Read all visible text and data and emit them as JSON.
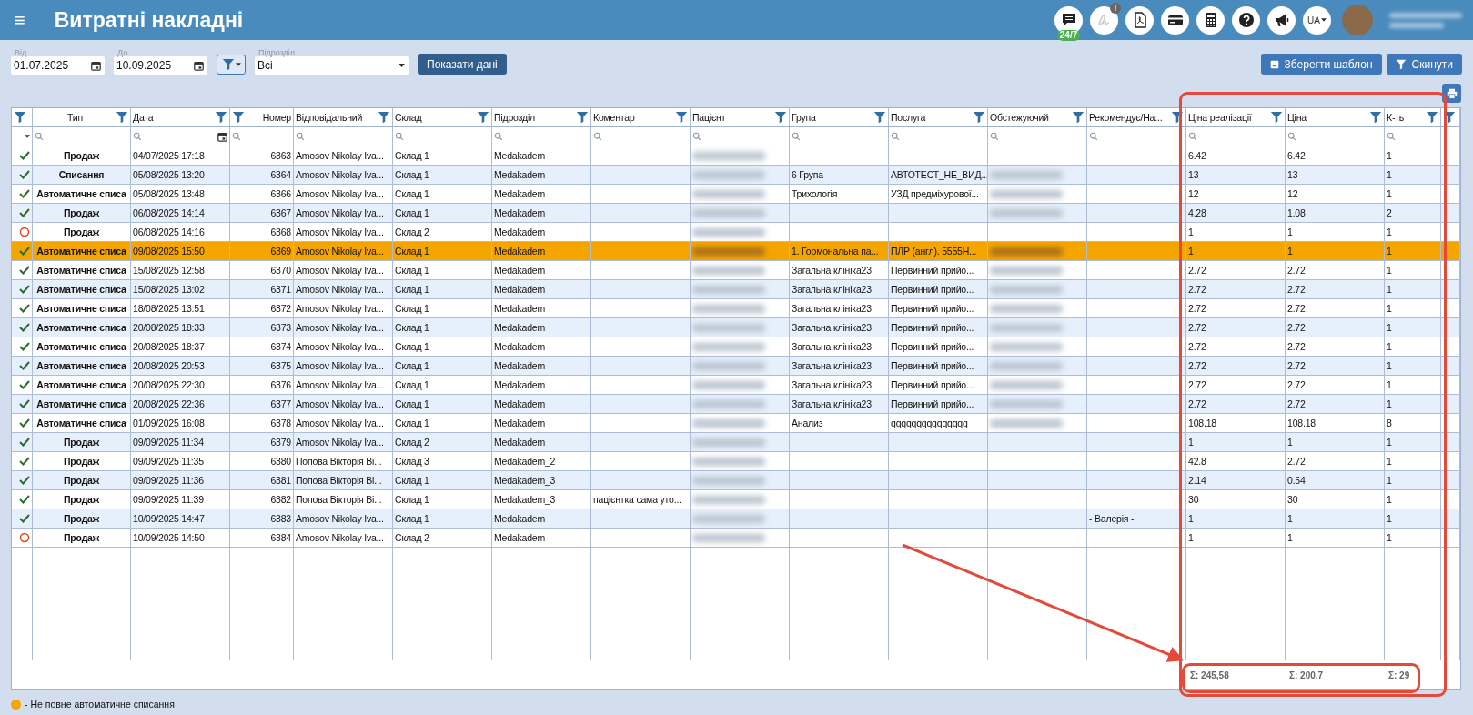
{
  "header": {
    "menu_icon": "≡",
    "title": "Витратні накладні",
    "chat_badge": "24/7",
    "alert_badge": "!",
    "language": "UA",
    "user_name_redacted": true
  },
  "filters": {
    "from": {
      "label": "Від",
      "value": "01.07.2025"
    },
    "to": {
      "label": "До",
      "value": "10.09.2025"
    },
    "department": {
      "label": "Підрозділ",
      "value": "Всі"
    },
    "show_button": "Показати дані",
    "save_template_button": "Зберегти шаблон",
    "reset_button": "Скинути"
  },
  "table": {
    "columns": [
      {
        "label": "Тип",
        "centered": true,
        "filter_left": false,
        "date_search": false
      },
      {
        "label": "Дата",
        "centered": false,
        "filter_left": false,
        "date_search": true
      },
      {
        "label": "Номер",
        "centered": false,
        "filter_left": true,
        "date_search": false
      },
      {
        "label": "Відповідальний",
        "centered": false,
        "filter_left": false,
        "date_search": false
      },
      {
        "label": "Склад",
        "centered": false,
        "filter_left": false,
        "date_search": false
      },
      {
        "label": "Підрозділ",
        "centered": false,
        "filter_left": false,
        "date_search": false
      },
      {
        "label": "Коментар",
        "centered": false,
        "filter_left": false,
        "date_search": false
      },
      {
        "label": "Пацієнт",
        "centered": false,
        "filter_left": false,
        "date_search": false
      },
      {
        "label": "Група",
        "centered": false,
        "filter_left": false,
        "date_search": false
      },
      {
        "label": "Послуга",
        "centered": false,
        "filter_left": false,
        "date_search": false
      },
      {
        "label": "Обстежуючий",
        "centered": false,
        "filter_left": false,
        "date_search": false
      },
      {
        "label": "Рекомендує/На...",
        "centered": false,
        "filter_left": false,
        "date_search": false
      },
      {
        "label": "Ціна реалізації",
        "centered": false,
        "filter_left": false,
        "date_search": false
      },
      {
        "label": "Ціна",
        "centered": false,
        "filter_left": false,
        "date_search": false
      },
      {
        "label": "К-ть",
        "centered": false,
        "filter_left": false,
        "date_search": false
      }
    ],
    "rows": [
      {
        "completed": true,
        "selected": false,
        "type": "Продаж",
        "date": "04/07/2025 17:18",
        "number": "6363",
        "responsible": "Amosov Nikolay Iva...",
        "warehouse": "Склад 1",
        "department": "Medakadem",
        "patient": true,
        "examiner": false,
        "sale_price": "6.42",
        "price": "6.42",
        "qty": "1"
      },
      {
        "completed": true,
        "selected": false,
        "type": "Списання",
        "date": "05/08/2025 13:20",
        "number": "6364",
        "responsible": "Amosov Nikolay Iva...",
        "warehouse": "Склад 1",
        "department": "Medakadem",
        "patient": true,
        "group": "6 Група",
        "service": "АВТОТЕСТ_НЕ_ВИД...",
        "examiner": true,
        "sale_price": "13",
        "price": "13",
        "qty": "1"
      },
      {
        "completed": true,
        "selected": false,
        "type": "Автоматичне списа",
        "date": "05/08/2025 13:48",
        "number": "6366",
        "responsible": "Amosov Nikolay Iva...",
        "warehouse": "Склад 1",
        "department": "Medakadem",
        "patient": true,
        "group": "Трихологія",
        "service": "УЗД предміхурової...",
        "examiner": true,
        "sale_price": "12",
        "price": "12",
        "qty": "1"
      },
      {
        "completed": true,
        "selected": false,
        "type": "Продаж",
        "date": "06/08/2025 14:14",
        "number": "6367",
        "responsible": "Amosov Nikolay Iva...",
        "warehouse": "Склад 1",
        "department": "Medakadem",
        "patient": true,
        "examiner": true,
        "sale_price": "4.28",
        "price": "1.08",
        "qty": "2"
      },
      {
        "completed": false,
        "selected": false,
        "type": "Продаж",
        "date": "06/08/2025 14:16",
        "number": "6368",
        "responsible": "Amosov Nikolay Iva...",
        "warehouse": "Склад 2",
        "department": "Medakadem",
        "patient": true,
        "examiner": false,
        "sale_price": "1",
        "price": "1",
        "qty": "1"
      },
      {
        "completed": true,
        "selected": true,
        "type": "Автоматичне списа",
        "date": "09/08/2025 15:50",
        "number": "6369",
        "responsible": "Amosov Nikolay Iva...",
        "warehouse": "Склад 1",
        "department": "Medakadem",
        "patient": true,
        "group": "1. Гормональна па...",
        "service": "ПЛР (англ). 5555Н...",
        "examiner": true,
        "sale_price": "1",
        "price": "1",
        "qty": "1"
      },
      {
        "completed": true,
        "selected": false,
        "type": "Автоматичне списа",
        "date": "15/08/2025 12:58",
        "number": "6370",
        "responsible": "Amosov Nikolay Iva...",
        "warehouse": "Склад 1",
        "department": "Medakadem",
        "patient": true,
        "group": "Загальна клініка23",
        "service": "Первинний прийо...",
        "examiner": true,
        "sale_price": "2.72",
        "price": "2.72",
        "qty": "1"
      },
      {
        "completed": true,
        "selected": false,
        "type": "Автоматичне списа",
        "date": "15/08/2025 13:02",
        "number": "6371",
        "responsible": "Amosov Nikolay Iva...",
        "warehouse": "Склад 1",
        "department": "Medakadem",
        "patient": true,
        "group": "Загальна клініка23",
        "service": "Первинний прийо...",
        "examiner": true,
        "sale_price": "2.72",
        "price": "2.72",
        "qty": "1"
      },
      {
        "completed": true,
        "selected": false,
        "type": "Автоматичне списа",
        "date": "18/08/2025 13:51",
        "number": "6372",
        "responsible": "Amosov Nikolay Iva...",
        "warehouse": "Склад 1",
        "department": "Medakadem",
        "patient": true,
        "group": "Загальна клініка23",
        "service": "Первинний прийо...",
        "examiner": true,
        "sale_price": "2.72",
        "price": "2.72",
        "qty": "1"
      },
      {
        "completed": true,
        "selected": false,
        "type": "Автоматичне списа",
        "date": "20/08/2025 18:33",
        "number": "6373",
        "responsible": "Amosov Nikolay Iva...",
        "warehouse": "Склад 1",
        "department": "Medakadem",
        "patient": true,
        "group": "Загальна клініка23",
        "service": "Первинний прийо...",
        "examiner": true,
        "sale_price": "2.72",
        "price": "2.72",
        "qty": "1"
      },
      {
        "completed": true,
        "selected": false,
        "type": "Автоматичне списа",
        "date": "20/08/2025 18:37",
        "number": "6374",
        "responsible": "Amosov Nikolay Iva...",
        "warehouse": "Склад 1",
        "department": "Medakadem",
        "patient": true,
        "group": "Загальна клініка23",
        "service": "Первинний прийо...",
        "examiner": true,
        "sale_price": "2.72",
        "price": "2.72",
        "qty": "1"
      },
      {
        "completed": true,
        "selected": false,
        "type": "Автоматичне списа",
        "date": "20/08/2025 20:53",
        "number": "6375",
        "responsible": "Amosov Nikolay Iva...",
        "warehouse": "Склад 1",
        "department": "Medakadem",
        "patient": true,
        "group": "Загальна клініка23",
        "service": "Первинний прийо...",
        "examiner": true,
        "sale_price": "2.72",
        "price": "2.72",
        "qty": "1"
      },
      {
        "completed": true,
        "selected": false,
        "type": "Автоматичне списа",
        "date": "20/08/2025 22:30",
        "number": "6376",
        "responsible": "Amosov Nikolay Iva...",
        "warehouse": "Склад 1",
        "department": "Medakadem",
        "patient": true,
        "group": "Загальна клініка23",
        "service": "Первинний прийо...",
        "examiner": true,
        "sale_price": "2.72",
        "price": "2.72",
        "qty": "1"
      },
      {
        "completed": true,
        "selected": false,
        "type": "Автоматичне списа",
        "date": "20/08/2025 22:36",
        "number": "6377",
        "responsible": "Amosov Nikolay Iva...",
        "warehouse": "Склад 1",
        "department": "Medakadem",
        "patient": true,
        "group": "Загальна клініка23",
        "service": "Первинний прийо...",
        "examiner": true,
        "sale_price": "2.72",
        "price": "2.72",
        "qty": "1"
      },
      {
        "completed": true,
        "selected": false,
        "type": "Автоматичне списа",
        "date": "01/09/2025 16:08",
        "number": "6378",
        "responsible": "Amosov Nikolay Iva...",
        "warehouse": "Склад 1",
        "department": "Medakadem",
        "patient": true,
        "group": "Анализ",
        "service": "qqqqqqqqqqqqqqq",
        "examiner": true,
        "sale_price": "108.18",
        "price": "108.18",
        "qty": "8"
      },
      {
        "completed": true,
        "selected": false,
        "type": "Продаж",
        "date": "09/09/2025 11:34",
        "number": "6379",
        "responsible": "Amosov Nikolay Iva...",
        "warehouse": "Склад 2",
        "department": "Medakadem",
        "patient": true,
        "examiner": false,
        "sale_price": "1",
        "price": "1",
        "qty": "1"
      },
      {
        "completed": true,
        "selected": false,
        "type": "Продаж",
        "date": "09/09/2025 11:35",
        "number": "6380",
        "responsible": "Попова Вікторія Ві...",
        "warehouse": "Склад 3",
        "department": "Medakadem_2",
        "patient": true,
        "examiner": false,
        "sale_price": "42.8",
        "price": "2.72",
        "qty": "1"
      },
      {
        "completed": true,
        "selected": false,
        "type": "Продаж",
        "date": "09/09/2025 11:36",
        "number": "6381",
        "responsible": "Попова Вікторія Ві...",
        "warehouse": "Склад 1",
        "department": "Medakadem_3",
        "patient": true,
        "examiner": false,
        "sale_price": "2.14",
        "price": "0.54",
        "qty": "1"
      },
      {
        "completed": true,
        "selected": false,
        "type": "Продаж",
        "date": "09/09/2025 11:39",
        "number": "6382",
        "responsible": "Попова Вікторія Ві...",
        "warehouse": "Склад 1",
        "department": "Medakadem_3",
        "comment": "пацієнтка сама уто...",
        "patient": true,
        "examiner": false,
        "sale_price": "30",
        "price": "30",
        "qty": "1"
      },
      {
        "completed": true,
        "selected": false,
        "type": "Продаж",
        "date": "10/09/2025 14:47",
        "number": "6383",
        "responsible": "Amosov Nikolay Iva...",
        "warehouse": "Склад 1",
        "department": "Medakadem",
        "patient": true,
        "examiner": false,
        "recommends": "- Валерія -",
        "sale_price": "1",
        "price": "1",
        "qty": "1"
      },
      {
        "completed": false,
        "selected": false,
        "type": "Продаж",
        "date": "10/09/2025 14:50",
        "number": "6384",
        "responsible": "Amosov Nikolay Iva...",
        "warehouse": "Склад 2",
        "department": "Medakadem",
        "patient": true,
        "examiner": false,
        "sale_price": "1",
        "price": "1",
        "qty": "1"
      }
    ],
    "totals": {
      "sale_price": "Σ: 245,58",
      "price": "Σ: 200,7",
      "qty": "Σ: 29"
    }
  },
  "legend": {
    "color": "#f5a500",
    "text": "- Не повне автоматичне списання"
  },
  "annotations": [
    {
      "kind": "columns-box"
    },
    {
      "kind": "totals-box"
    },
    {
      "kind": "arrow"
    }
  ]
}
